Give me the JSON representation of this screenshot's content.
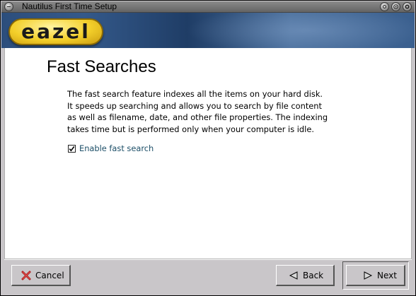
{
  "window": {
    "title": "Nautilus First Time Setup"
  },
  "banner": {
    "logo_text": "eazel",
    "logo_colors": {
      "pill": "#f3cf2a",
      "text": "#1a1a1a"
    }
  },
  "page": {
    "title": "Fast Searches",
    "description": "The fast search feature indexes all the items on your hard disk.\nIt speeds up searching and allows you to search by file content\nas well as filename, date, and other file properties. The indexing\ntakes time but is performed only when your computer is idle.",
    "checkbox": {
      "label": "Enable fast search",
      "checked": true
    }
  },
  "buttons": {
    "cancel": {
      "label": "Cancel",
      "icon": "cancel-x-icon"
    },
    "back": {
      "label": "Back",
      "icon": "arrow-left-icon"
    },
    "next": {
      "label": "Next",
      "icon": "arrow-right-icon"
    }
  },
  "icons": {
    "titlebar_menu": "window-menu-icon",
    "minimize": "minimize-icon",
    "maximize": "maximize-icon",
    "close": "close-icon"
  },
  "colors": {
    "banner_blue": "#2c4e7c",
    "checkbox_label": "#1d4f68",
    "cancel_icon": "#b02020",
    "nav_arrow": "#d8d8d8"
  }
}
